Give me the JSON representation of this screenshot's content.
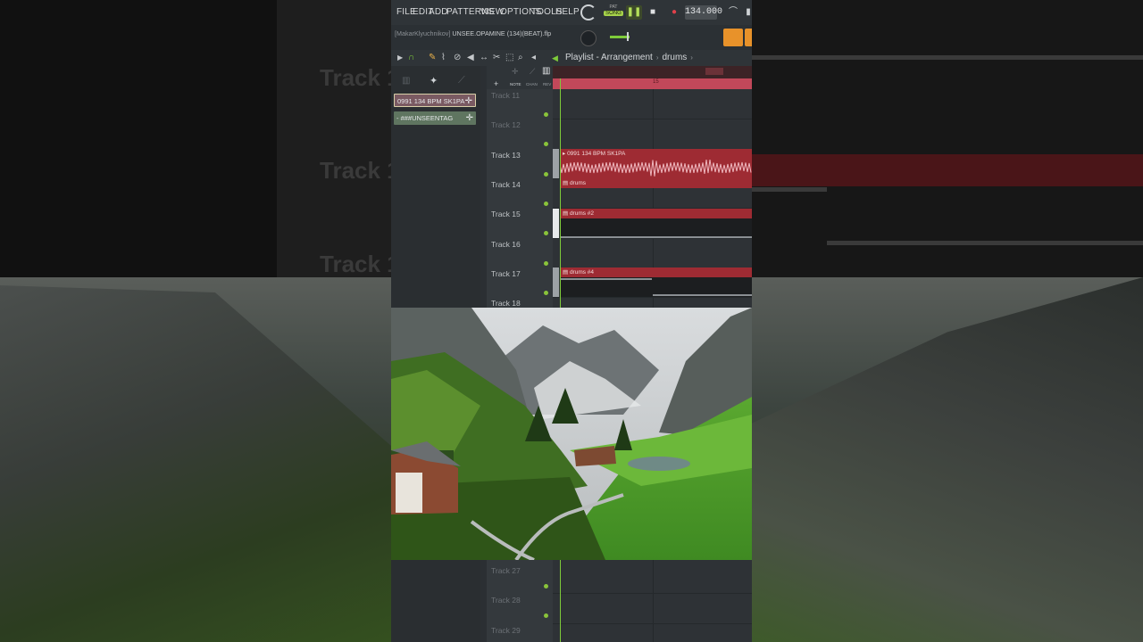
{
  "menu": [
    "FILE",
    "EDIT",
    "ADD",
    "PATTERNS",
    "VIEW",
    "OPTIONS",
    "TOOLS",
    "HELP"
  ],
  "transport": {
    "pat_label": "PAT",
    "song_label": "SONG",
    "tempo": "134.000"
  },
  "hint": {
    "user": "[MakarKlyuchnikov]",
    "project": "UNSEE.OPAMINE (134)(BEAT).flp"
  },
  "breadcrumb": [
    "Playlist - Arrangement",
    "drums"
  ],
  "picker": [
    {
      "name": "0991 134 BPM SK1PA",
      "color": "#7a5a62"
    },
    {
      "name": "- ###UNSEENTAG",
      "color": "#5f7560"
    }
  ],
  "track_column_header": [
    "NOTE",
    "CHAN",
    "REV"
  ],
  "ruler": {
    "bar": "15"
  },
  "tracks_top": [
    "Track 11",
    "Track 12",
    "Track 13",
    "Track 14",
    "Track 15",
    "Track 16",
    "Track 17",
    "Track 18"
  ],
  "tracks_bottom": [
    "Track 27",
    "Track 28",
    "Track 29"
  ],
  "clips": [
    {
      "track": "Track 13",
      "name": "0991 134 BPM SK1PA",
      "kind": "audio"
    },
    {
      "track": "Track 14",
      "name": "drums",
      "kind": "pattern"
    },
    {
      "track": "Track 15",
      "name": "drums #2",
      "kind": "pattern"
    },
    {
      "track": "Track 17",
      "name": "drums #4",
      "kind": "pattern"
    }
  ],
  "background_tracks": [
    "Track 1",
    "Track 1",
    "Track 1"
  ],
  "colors": {
    "clip": "#9e2b33",
    "accent_green": "#7ecb3a",
    "ruler": "#c2485a",
    "orange": "#e8922a"
  }
}
